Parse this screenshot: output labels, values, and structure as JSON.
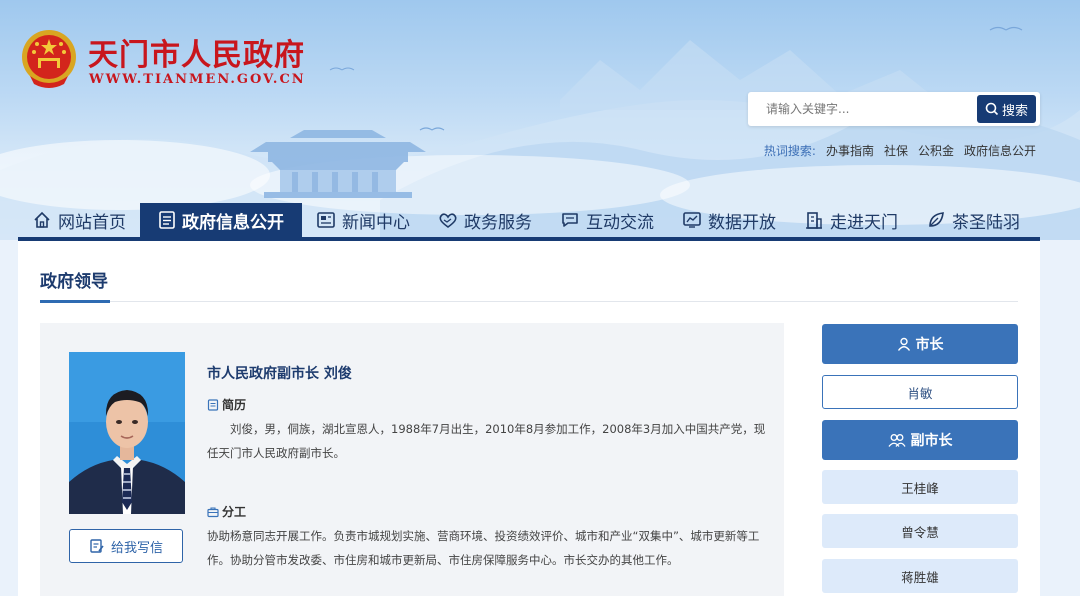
{
  "site": {
    "title": "天门市人民政府",
    "url": "WWW.TIANMEN.GOV.CN",
    "colors": {
      "brand_red": "#c8161d",
      "nav_dark": "#173b74",
      "accent_blue": "#3a73b9"
    }
  },
  "search": {
    "placeholder": "请输入关键字...",
    "button_label": "搜索",
    "hot_label": "热词搜索:",
    "hot_terms": [
      "办事指南",
      "社保",
      "公积金",
      "政府信息公开"
    ]
  },
  "nav": {
    "items": [
      {
        "label": "网站首页",
        "icon": "home-icon"
      },
      {
        "label": "政府信息公开",
        "icon": "document-icon",
        "active": true
      },
      {
        "label": "新闻中心",
        "icon": "newspaper-icon"
      },
      {
        "label": "政务服务",
        "icon": "heart-hand-icon"
      },
      {
        "label": "互动交流",
        "icon": "chat-icon"
      },
      {
        "label": "数据开放",
        "icon": "chart-icon"
      },
      {
        "label": "走进天门",
        "icon": "building-icon"
      },
      {
        "label": "茶圣陆羽",
        "icon": "leaf-icon"
      }
    ]
  },
  "section": {
    "title": "政府领导"
  },
  "leader": {
    "name_title": "市人民政府副市长  刘俊",
    "resume_label": "简历",
    "resume_text": "刘俊，男，侗族，湖北宣恩人，1988年7月出生，2010年8月参加工作，2008年3月加入中国共产党，现任天门市人民政府副市长。",
    "duty_label": "分工",
    "duty_text": "协助杨意同志开展工作。负责市城规划实施、营商环境、投资绩效评价、城市和产业“双集中”、城市更新等工作。协助分管市发改委、市住房和城市更新局、市住房保障服务中心。市长交办的其他工作。",
    "letter_button": "给我写信"
  },
  "sidebar": {
    "mayor_header": "市长",
    "mayor": "肖敏",
    "vice_header": "副市长",
    "vice_mayors": [
      "王桂峰",
      "曾令慧",
      "蒋胜雄"
    ]
  }
}
